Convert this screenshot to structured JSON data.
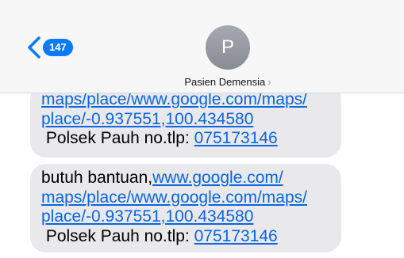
{
  "header": {
    "back_count": "147",
    "avatar_initial": "P",
    "contact_name": "Pasien Demensia",
    "contact_chevron": "›"
  },
  "messages": [
    {
      "line1_link": "maps/place/www.google.com/maps/",
      "line2_link": "place/-0.937551,100.434580",
      "line3_text": " Polsek Pauh no.tlp: ",
      "line3_link": "075173146"
    },
    {
      "line1_text": "butuh bantuan,",
      "line1_link": "www.google.com/",
      "line2_link": "maps/place/www.google.com/maps/",
      "line3_link": "place/-0.937551,100.434580",
      "line4_text": " Polsek Pauh no.tlp: ",
      "line4_link": "075173146"
    }
  ],
  "colors": {
    "accent": "#0a7bff",
    "link": "#0a66e0",
    "bubble": "#e9e9eb",
    "avatar": "#9a9ca4"
  },
  "icons": {
    "back": "chevron-left-icon",
    "contact_detail": "chevron-right-icon"
  }
}
